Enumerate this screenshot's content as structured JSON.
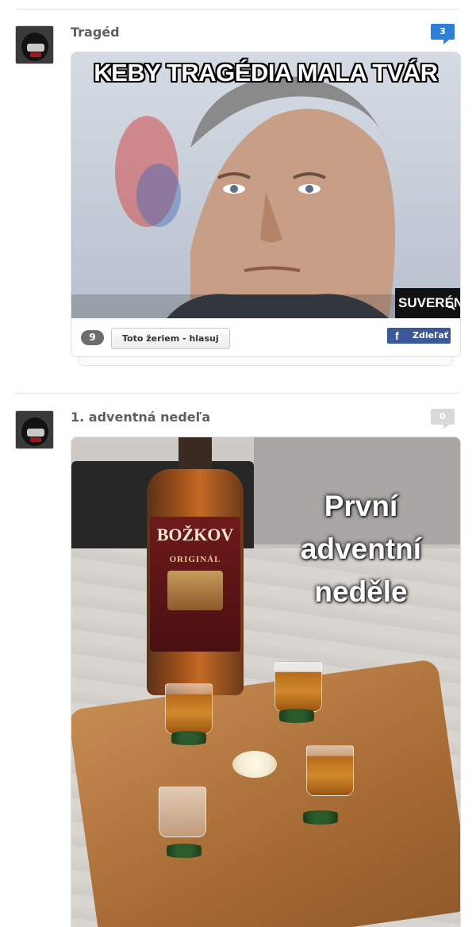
{
  "posts": [
    {
      "title": "Tragéd",
      "comment_count": "3",
      "meme_caption": "KEBY TRAGÉDIA MALA TVÁR",
      "watermark": "SUVERÉN",
      "vote_count": "9",
      "vote_label": "Toto žeriem - hlasuj",
      "share_label": "Zdieľať",
      "icons": [
        "avatar",
        "comment-icon",
        "zoom-icon",
        "facebook-icon"
      ],
      "colors": {
        "badge": "#2f7fd6",
        "facebook": "#3b5998"
      }
    },
    {
      "title": "1. adventná nedeľa",
      "comment_count": "0",
      "meme_lines": [
        "První",
        "adventní",
        "neděle"
      ],
      "bottle_brand": "BOŽKOV",
      "bottle_sub": "ORIGINÁL",
      "icons": [
        "avatar",
        "comment-icon"
      ],
      "colors": {
        "badge": "#d9d9d9"
      }
    }
  ]
}
